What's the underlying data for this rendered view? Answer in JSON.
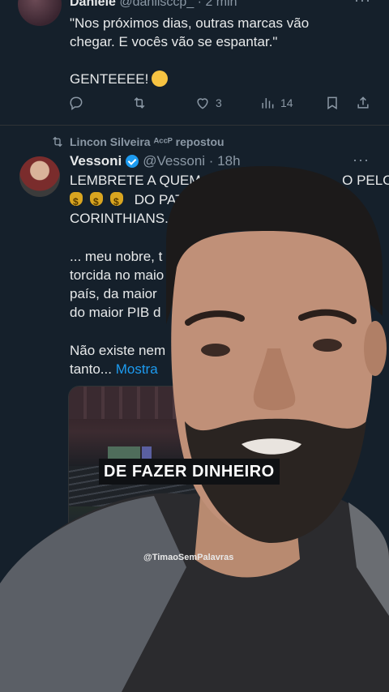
{
  "tweet1": {
    "name": "Daniele",
    "handle": "@danilsccp_ · 2 min",
    "text": "\"Nos próximos dias, outras marcas vão chegar. E vocês vão se espantar.\"",
    "exclaim": "GENTEEEE!",
    "likes": "3",
    "views": "14"
  },
  "tweet2": {
    "repost_label": "Lincon Silveira ᴬᶜᶜᴾ repostou",
    "name": "Vessoni",
    "handle": "@Vessoni · 18h",
    "line1": "LEMBRETE A QUEM ESTÁ",
    "line1_end": "O PELO",
    "line2_end": "DO PATRO",
    "line3": "CORINTHIANS...",
    "line4": "... meu nobre, t",
    "line5": "torcida no maio",
    "line6": "país, da maior",
    "line7": "do maior PIB d",
    "line8": "Não existe nem",
    "line9_start": "tanto...",
    "show_more": "Mostra"
  },
  "overlay": {
    "caption": "DE FAZER DINHEIRO",
    "watermark": "@TimaoSemPalavras"
  },
  "colors": {
    "background": "#15202b",
    "accent": "#1d9bf0",
    "muted": "#8b98a5"
  }
}
